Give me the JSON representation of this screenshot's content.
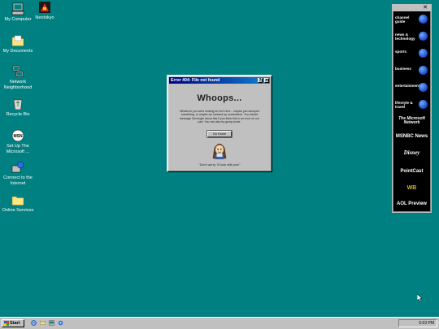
{
  "desktop": {
    "icons": [
      {
        "label": "My Computer",
        "icon": "my-computer-icon"
      },
      {
        "label": "Neotokyo",
        "icon": "neotokyo-icon"
      },
      {
        "label": "My Documents",
        "icon": "folder-icon"
      },
      {
        "label": "Network Neighborhood",
        "icon": "network-icon"
      },
      {
        "label": "Recycle Bin",
        "icon": "recycle-bin-icon"
      },
      {
        "label": "Set Up The Microsoft ...",
        "icon": "msn-setup-icon"
      },
      {
        "label": "Connect to the Internet",
        "icon": "internet-connect-icon"
      },
      {
        "label": "Online Services",
        "icon": "folder-icon"
      }
    ]
  },
  "dialog": {
    "title": "Error 404: File not found",
    "help_btn": "?",
    "close_btn": "✕",
    "heading": "Whoops...",
    "message": "Whatever you were looking for isn't here... maybe you stumped something, or maybe we messed up somewhere. You should message Dennogin about this if you think this is an error on our part. You can also try going home.",
    "button_label": "Go Home",
    "caption": "\"Don't worry, I'll look with you!\""
  },
  "channel_bar": {
    "close": "✕",
    "items": [
      {
        "label": "channel guide"
      },
      {
        "label": "news & technology"
      },
      {
        "label": "sports"
      },
      {
        "label": "business"
      },
      {
        "label": "entertainment"
      },
      {
        "label": "lifestyle & travel"
      },
      {
        "label": "The Microsoft Network"
      },
      {
        "label": "MSNBC News"
      },
      {
        "label": "Disney"
      },
      {
        "label": "PointCast"
      },
      {
        "label": "WB"
      },
      {
        "label": "AOL Preview"
      }
    ]
  },
  "taskbar": {
    "start_label": "Start",
    "clock": "5:03 PM"
  }
}
